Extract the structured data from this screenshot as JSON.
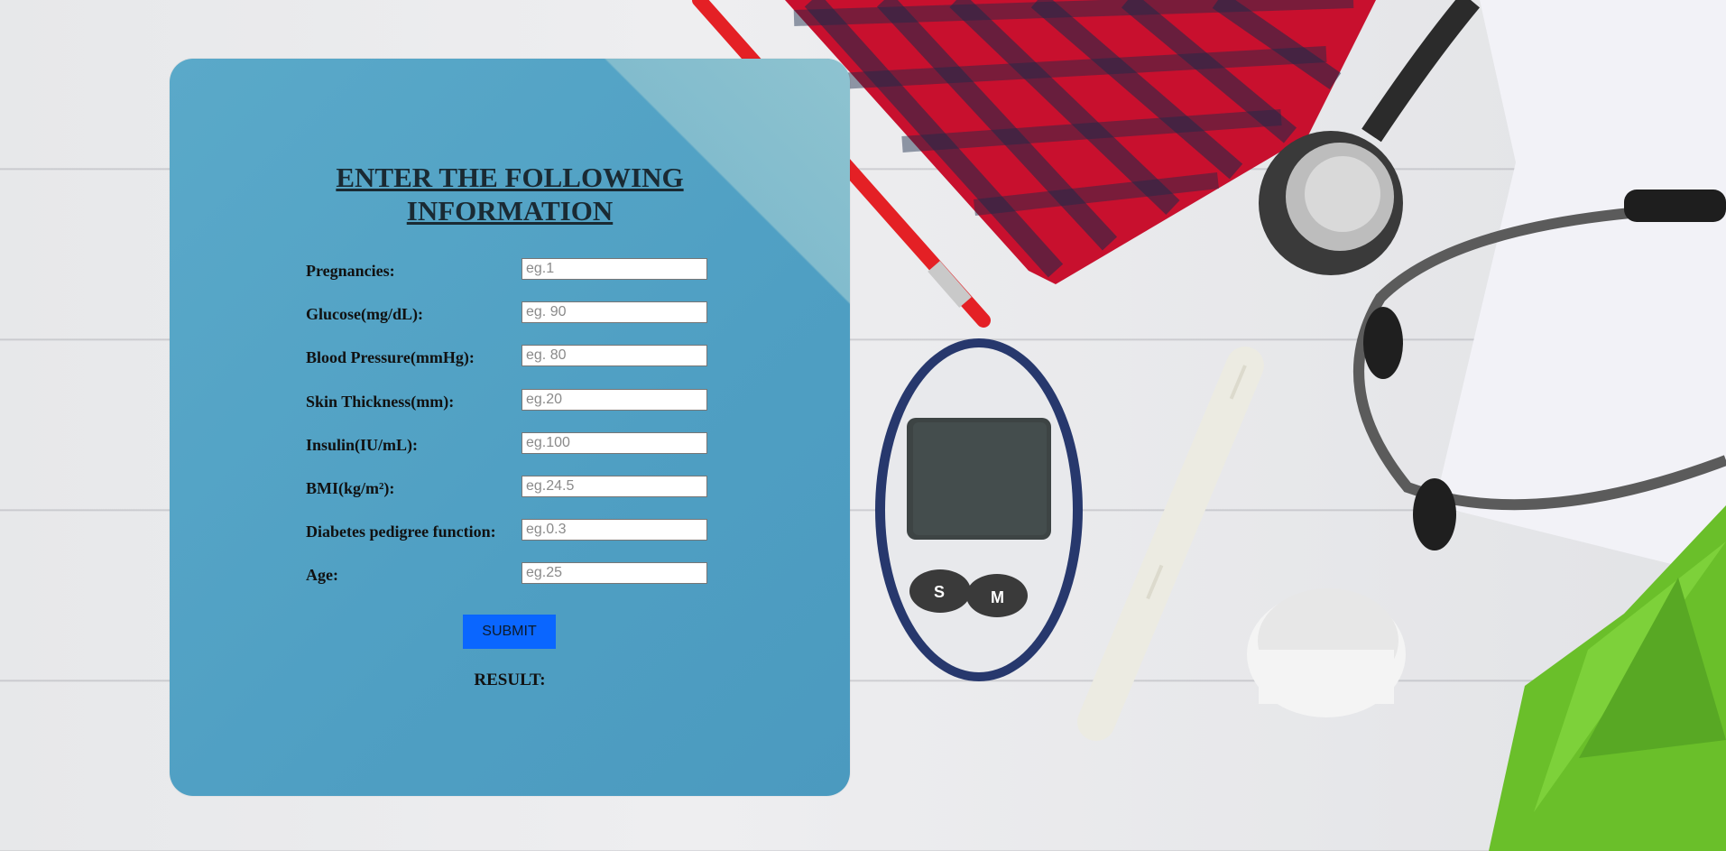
{
  "form": {
    "title_line1": "ENTER THE FOLLOWING",
    "title_line2": "INFORMATION",
    "fields": [
      {
        "label": "Pregnancies:",
        "placeholder": "eg.1",
        "value": ""
      },
      {
        "label": "Glucose(mg/dL):",
        "placeholder": "eg. 90",
        "value": ""
      },
      {
        "label": "Blood Pressure(mmHg):",
        "placeholder": "eg. 80",
        "value": ""
      },
      {
        "label": "Skin Thickness(mm):",
        "placeholder": "eg.20",
        "value": ""
      },
      {
        "label": "Insulin(IU/mL):",
        "placeholder": "eg.100",
        "value": ""
      },
      {
        "label": "BMI(kg/m²):",
        "placeholder": "eg.24.5",
        "value": ""
      },
      {
        "label": "Diabetes pedigree function:",
        "placeholder": "eg.0.3",
        "value": ""
      },
      {
        "label": "Age:",
        "placeholder": "eg.25",
        "value": ""
      }
    ],
    "submit_label": "SUBMIT",
    "result_label": "RESULT:"
  },
  "colors": {
    "card_background": "#5aa9c9",
    "submit_button": "#0a66ff",
    "title_text": "#1a2a33"
  }
}
